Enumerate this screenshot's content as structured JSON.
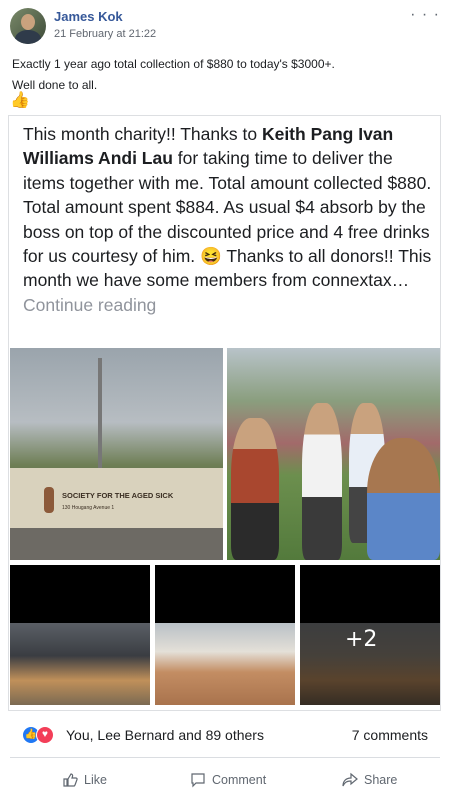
{
  "post": {
    "author": "James Kok",
    "timestamp": "21 February at 21:22",
    "more_icon": "more-options-icon",
    "caption_line1": "Exactly 1 year ago total collection of $880 to today's $3000+.",
    "caption_line2": "Well done to all.",
    "caption_emoji": "👍"
  },
  "shared": {
    "text_prefix": "This month charity!! Thanks to ",
    "text_bold": "Keith Pang Ivan Williams Andi Lau",
    "text_suffix": " for taking time to deliver the items together with me. Total amount collected $880. Total amount spent $884. As usual $4 absorb by the boss on top of the discounted price and 4 free drinks for us courtesy of him. 😆 Thanks to all donors!! This month we have some members from connextax… ",
    "continue": "Continue reading",
    "photo1_sign_title": "SOCIETY FOR THE AGED SICK",
    "photo1_sign_sub": "130 Hougang Avenue 1",
    "more_photos": "+2"
  },
  "stats": {
    "reactions": "You, Lee Bernard and 89 others",
    "comments": "7 comments"
  },
  "actions": {
    "like": "Like",
    "comment": "Comment",
    "share": "Share"
  },
  "colors": {
    "author": "#365899",
    "like_badge": "#2078f4",
    "love_badge": "#f33e58"
  }
}
